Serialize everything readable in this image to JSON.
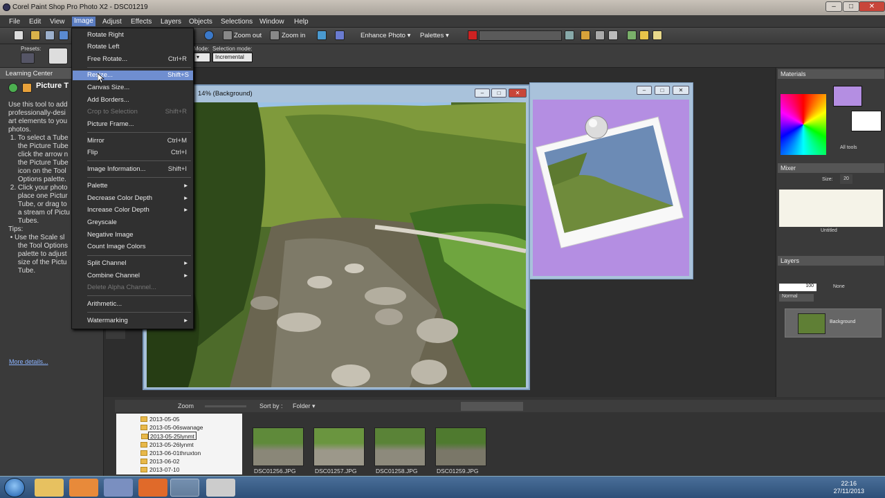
{
  "window": {
    "title": "Corel Paint Shop Pro Photo X2 - DSC01219",
    "min": "–",
    "max": "□",
    "close": "✕"
  },
  "menubar": [
    "File",
    "Edit",
    "View",
    "Image",
    "Adjust",
    "Effects",
    "Layers",
    "Objects",
    "Selections",
    "Window",
    "Help"
  ],
  "toolbar": {
    "zoom_out": "Zoom out",
    "zoom_in": "Zoom in",
    "enhance": "Enhance Photo",
    "palettes": "Palettes",
    "dropdown_arrow": "▾"
  },
  "options": {
    "presets": "Presets:",
    "mode": "Mode:",
    "selection_mode": "Selection mode:",
    "selection_value": "Incremental"
  },
  "image_menu": {
    "items": [
      {
        "label": "Rotate Right",
        "shortcut": ""
      },
      {
        "label": "Rotate Left",
        "shortcut": ""
      },
      {
        "label": "Free Rotate...",
        "shortcut": "Ctrl+R"
      },
      {
        "label": "Resize...",
        "shortcut": "Shift+S"
      },
      {
        "label": "Canvas Size...",
        "shortcut": ""
      },
      {
        "label": "Add Borders...",
        "shortcut": ""
      },
      {
        "label": "Crop to Selection",
        "shortcut": "Shift+R"
      },
      {
        "label": "Picture Frame...",
        "shortcut": ""
      },
      {
        "label": "Mirror",
        "shortcut": "Ctrl+M"
      },
      {
        "label": "Flip",
        "shortcut": "Ctrl+I"
      },
      {
        "label": "Image Information...",
        "shortcut": "Shift+I"
      },
      {
        "label": "Palette",
        "shortcut": ""
      },
      {
        "label": "Decrease Color Depth",
        "shortcut": ""
      },
      {
        "label": "Increase Color Depth",
        "shortcut": ""
      },
      {
        "label": "Greyscale",
        "shortcut": ""
      },
      {
        "label": "Negative Image",
        "shortcut": ""
      },
      {
        "label": "Count Image Colors",
        "shortcut": ""
      },
      {
        "label": "Split Channel",
        "shortcut": ""
      },
      {
        "label": "Combine Channel",
        "shortcut": ""
      },
      {
        "label": "Delete Alpha Channel...",
        "shortcut": ""
      },
      {
        "label": "Arithmetic...",
        "shortcut": ""
      },
      {
        "label": "Watermarking",
        "shortcut": ""
      }
    ],
    "submenu_arrow": "▸"
  },
  "learning_center": {
    "header": "Learning Center",
    "title": "Picture T",
    "body": "Use this tool to add\nprofessionally-desi\nart elements to you\nphotos.\n 1. To select a Tube\n     the Picture Tube\n     click the arrow n\n     the Picture Tube\n     icon on the Tool\n     Options palette.\n 2. Click your photo\n     place one Pictur\n     Tube, or drag to\n     a stream of Pictu\n     Tubes.\nTips:\n • Use the Scale sl\n     the Tool Options\n     palette to adjust\n     size of the Pictu\n     Tube.",
    "more": "More details..."
  },
  "photo_window": {
    "title": "14% (Background)"
  },
  "right_panels": {
    "materials": "Materials",
    "all_tools": "All tools",
    "mixer": "Mixer",
    "mixer_size_label": "Size:",
    "mixer_size": "20",
    "untitled": "Untitled",
    "layers": "Layers",
    "opacity": "100",
    "blend_none": "None",
    "blend_mode": "Normal",
    "layer_name": "Background"
  },
  "organizer": {
    "zoom": "Zoom",
    "sort_by": "Sort by :",
    "sort_value": "Folder",
    "folders": [
      "2013-05-05",
      "2013-05-06swanage",
      "2013-05-25lynmt",
      "2013-05-26lynmt",
      "2013-06-01thruxton",
      "2013-06-02",
      "2013-07-10"
    ],
    "selected_folder": "2013-05-25lynmt",
    "thumbs": [
      "DSC01256.JPG",
      "DSC01257.JPG",
      "DSC01258.JPG",
      "DSC01259.JPG"
    ]
  },
  "taskbar": {
    "time": "22:16",
    "date": "27/11/2013"
  }
}
